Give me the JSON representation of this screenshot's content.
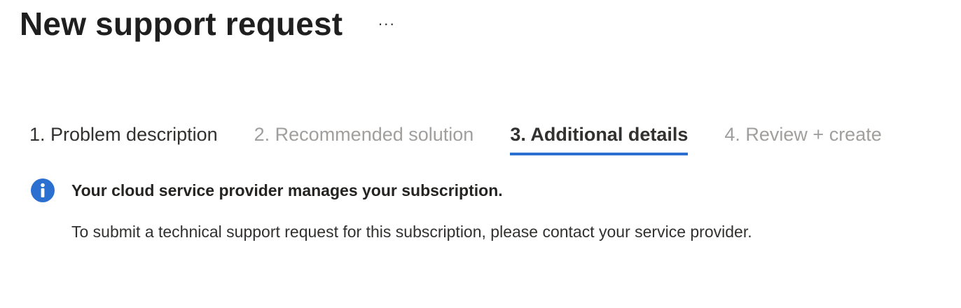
{
  "header": {
    "title": "New support request",
    "more_label": "···"
  },
  "tabs": [
    {
      "label": "1. Problem description",
      "state": "completed"
    },
    {
      "label": "2. Recommended solution",
      "state": "disabled"
    },
    {
      "label": "3. Additional details",
      "state": "current"
    },
    {
      "label": "4. Review + create",
      "state": "disabled"
    }
  ],
  "info": {
    "icon": "info-icon",
    "heading": "Your cloud service provider manages your subscription.",
    "body": "To submit a technical support request for this subscription, please contact your service provider."
  },
  "colors": {
    "accent": "#2b6fd0",
    "disabled_text": "#a19f9d",
    "text": "#323130"
  }
}
